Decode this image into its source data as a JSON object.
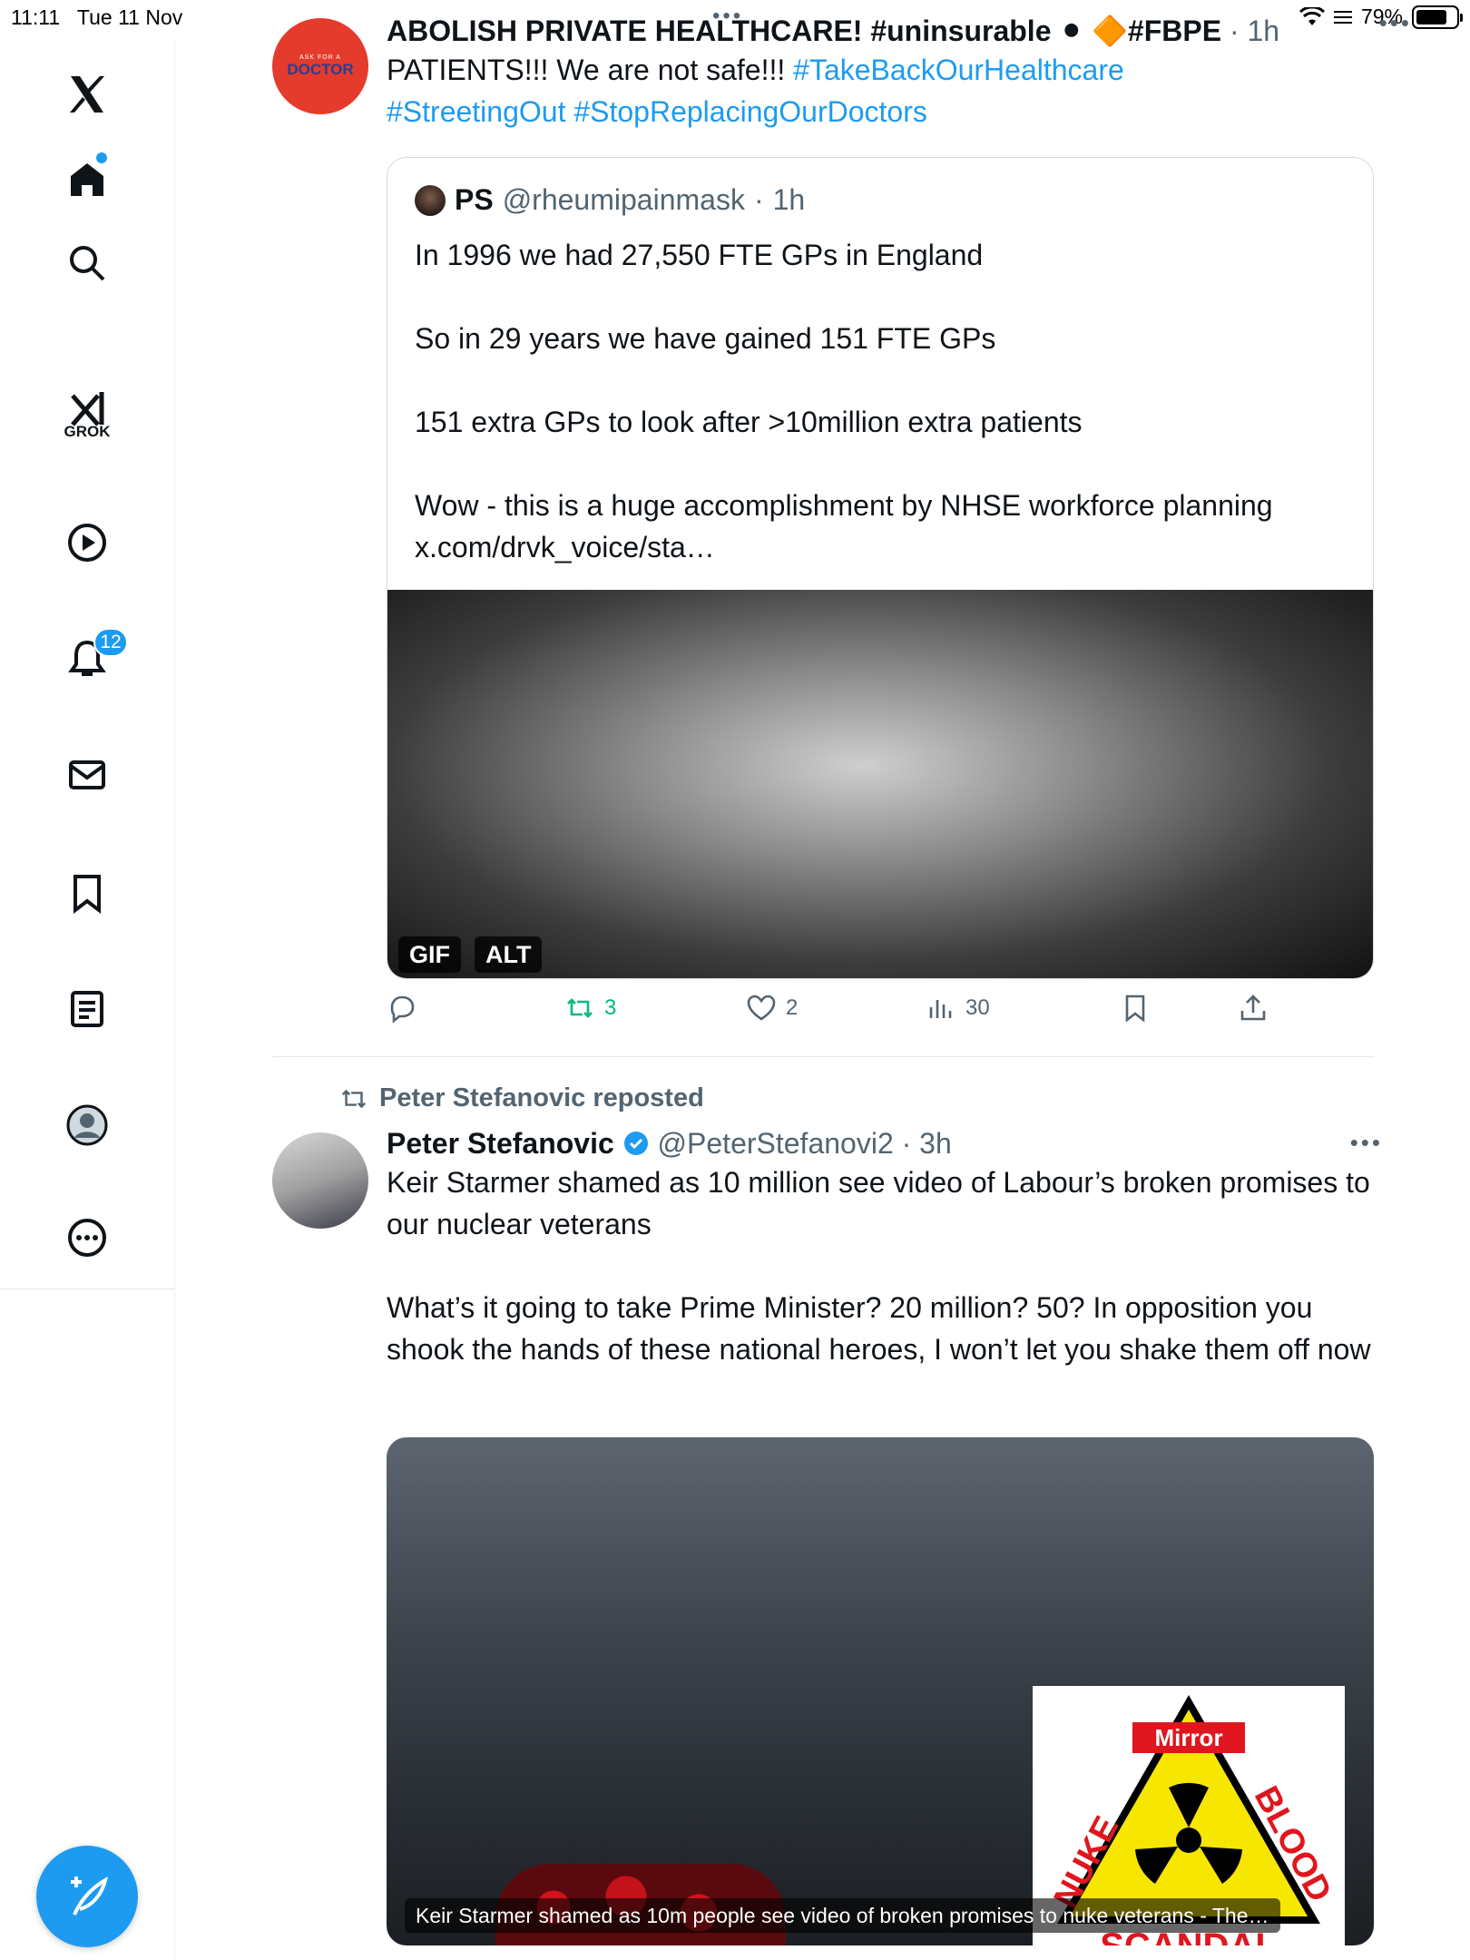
{
  "status_bar": {
    "time": "11:11",
    "date": "Tue 11 Nov",
    "battery": "79%",
    "battery_level": 0.79
  },
  "sidebar": {
    "icons": [
      "x-logo-icon",
      "home-icon",
      "search-icon",
      "grok-icon",
      "video-icon",
      "notifications-icon",
      "messages-icon",
      "bookmarks-icon",
      "lists-icon",
      "profile-icon",
      "more-icon"
    ],
    "grok_label": "GROK",
    "notification_count": "12"
  },
  "posts": [
    {
      "avatar": {
        "line1": "ASK FOR A",
        "line2": "DOCTOR"
      },
      "header_name": "ABOLISH PRIVATE HEALTHCARE! #uninsurable ⚫ 🔶#FBPE",
      "time": "1h",
      "text_plain": "PATIENTS!!! We are not safe!!! ",
      "hashtag_1": "#TakeBackOurHealthcare",
      "hashtag_2": "#StreetingOut",
      "hashtag_3": "#StopReplacingOurDoctors",
      "quote": {
        "name": "PS",
        "handle": "@rheumipainmask",
        "time": "1h",
        "text": "In 1996 we had 27,550 FTE GPs in England\n\nSo in 29 years we have gained 151 FTE GPs\n\n151 extra GPs to look after >10million extra patients\n\nWow - this is a huge accomplishment by NHSE workforce planning\nx.com/drvk_voice/sta…",
        "media_chips": [
          "GIF",
          "ALT"
        ]
      },
      "actions": {
        "replies": "",
        "reposts": "3",
        "likes": "2",
        "views": "30"
      }
    },
    {
      "repost_label": "Peter Stefanovic reposted",
      "author_name": "Peter Stefanovic",
      "handle": "@PeterStefanovi2",
      "time": "3h",
      "text": "Keir Starmer shamed as 10 million see video of Labour’s broken promises to our nuclear veterans\n\nWhat’s it going to take Prime Minister? 20 million? 50? In opposition you shook the hands of these national heroes, I won’t let you shake them off now",
      "media": {
        "sign_brand": "Mirror",
        "sign_word_1": "NUKE",
        "sign_word_2": "BLOOD",
        "sign_word_3": "SCANDAL",
        "caption": "Keir Starmer shamed as 10m people see video of broken promises to nuke veterans - The…"
      }
    }
  ],
  "colors": {
    "accent": "#1d9bf0",
    "retweet": "#00ba7c",
    "muted": "#536471",
    "notification_badge": "#1d9bf0",
    "avatar_red": "#e53b2c"
  }
}
